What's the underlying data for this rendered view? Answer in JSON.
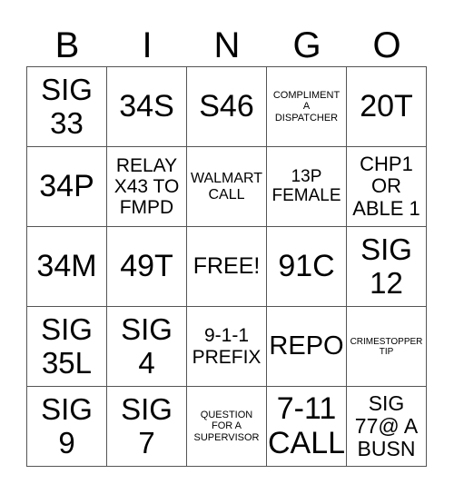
{
  "header": [
    "B",
    "I",
    "N",
    "G",
    "O"
  ],
  "cells": [
    [
      "SIG\n33",
      "34S",
      "S46",
      "COMPLIMENT\nA\nDISPATCHER",
      "20T"
    ],
    [
      "34P",
      "RELAY\nX43 TO\nFMPD",
      "WALMART\nCALL",
      "13P\nFEMALE",
      "CHP1\nOR\nABLE 1"
    ],
    [
      "34M",
      "49T",
      "FREE!",
      "91C",
      "SIG\n12"
    ],
    [
      "SIG\n35L",
      "SIG\n4",
      "9-1-1\nPREFIX",
      "REPO",
      "CRIMESTOPPER\nTIP"
    ],
    [
      "SIG\n9",
      "SIG\n7",
      "QUESTION\nFOR A\nSUPERVISOR",
      "7-11\nCALL",
      "SIG\n77@ A\nBUSN"
    ]
  ]
}
